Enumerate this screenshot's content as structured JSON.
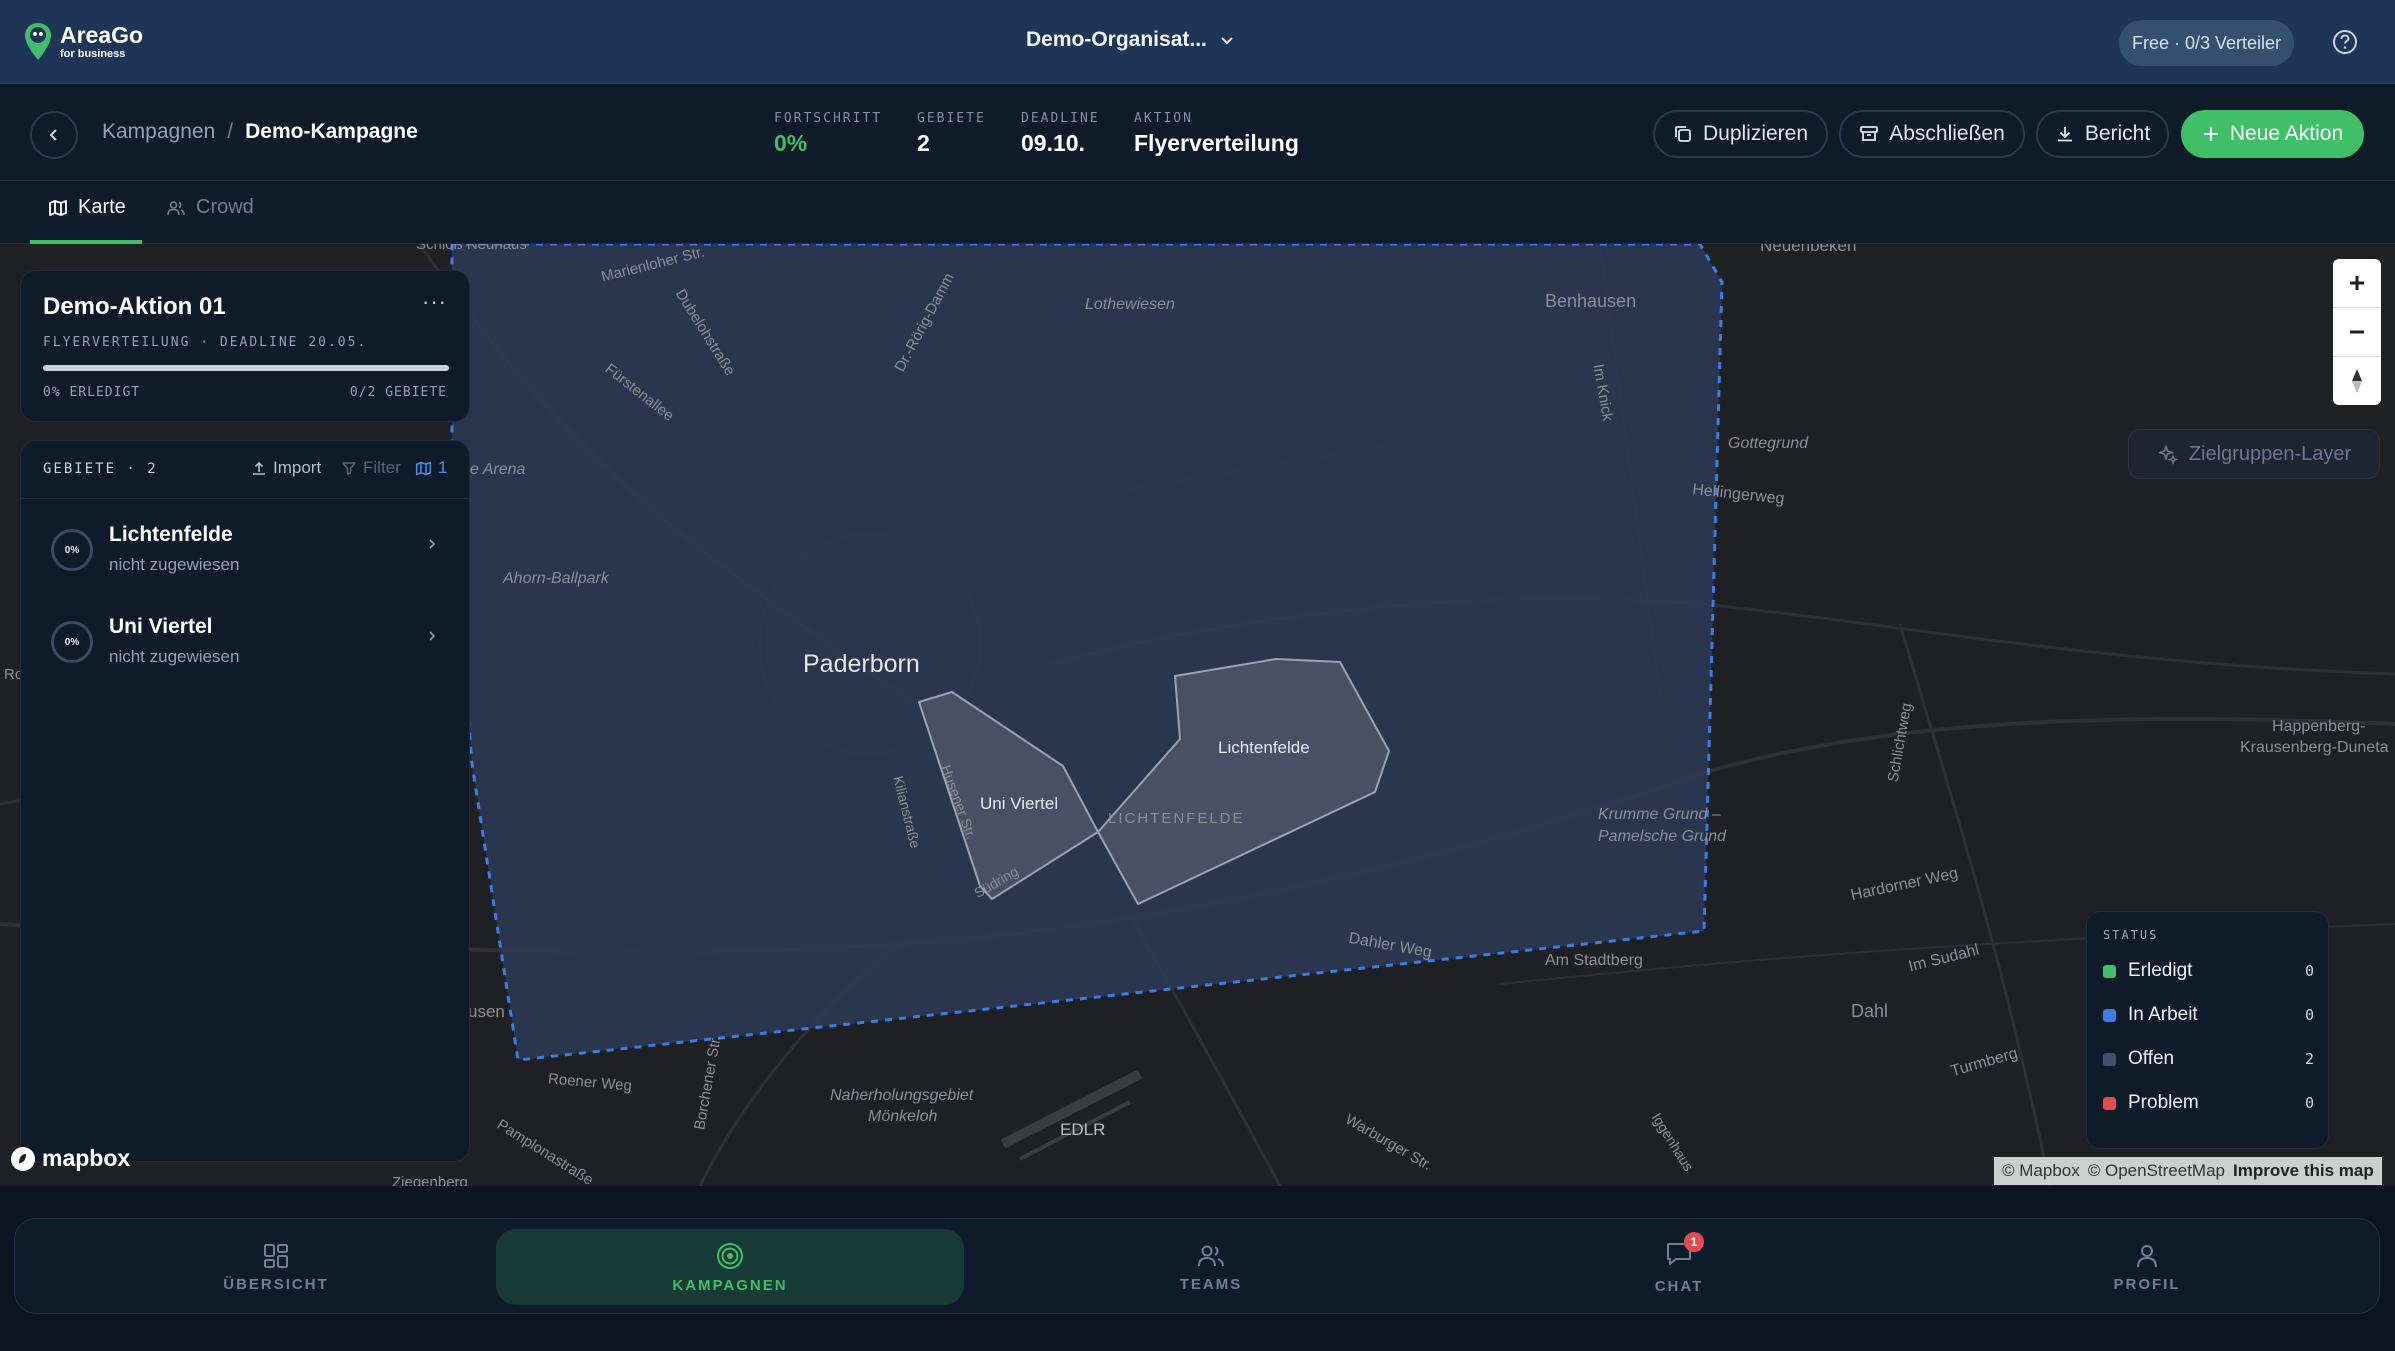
{
  "app": {
    "brand": "AreaGo",
    "brand_sub": "for business",
    "org_name": "Demo-Organisat...",
    "plan": "Free · 0/3 Verteiler"
  },
  "breadcrumb": {
    "parent": "Kampagnen",
    "separator": "/",
    "current": "Demo-Kampagne"
  },
  "stats": {
    "progress": {
      "label": "FORTSCHRITT",
      "value": "0%"
    },
    "areas": {
      "label": "GEBIETE",
      "value": "2"
    },
    "deadline": {
      "label": "DEADLINE",
      "value": "09.10."
    },
    "action": {
      "label": "AKTION",
      "value": "Flyerverteilung"
    }
  },
  "header_buttons": {
    "duplicate": "Duplizieren",
    "close": "Abschließen",
    "report": "Bericht",
    "new_action": "Neue Aktion"
  },
  "tabs": [
    {
      "label": "Karte",
      "icon": "map-icon",
      "active": true
    },
    {
      "label": "Crowd",
      "icon": "users-icon",
      "active": false
    }
  ],
  "action_card": {
    "title": "Demo-Aktion 01",
    "more": "···",
    "meta": "FLYERVERTEILUNG · DEADLINE 20.05.",
    "progress_fraction": 0,
    "done_label": "0% ERLEDIGT",
    "areas_label": "0/2 GEBIETE"
  },
  "areas_panel": {
    "title": "GEBIETE · 2",
    "import": "Import",
    "filter": "Filter",
    "map_count": "1",
    "items": [
      {
        "name": "Lichtenfelde",
        "status": "nicht zugewiesen",
        "progress": "0%"
      },
      {
        "name": "Uni Viertel",
        "status": "nicht zugewiesen",
        "progress": "0%"
      }
    ]
  },
  "map": {
    "labels": {
      "paderborn": "Paderborn",
      "benhausen": "Benhausen",
      "dahl": "Dahl",
      "lothewiesen": "Lothewiesen",
      "ahorn": "Ahorn-Ballpark",
      "arena": "e Arena",
      "gottegrund": "Gottegrund",
      "hellinger": "Hellingerweg",
      "krumme1": "Krumme Grund –",
      "krumme2": "Pamelsche Grund",
      "happenberg1": "Happenberg-",
      "happenberg2": "Krausenberg-Duneta",
      "hardorner": "Hardorner Weg",
      "imsudahl": "Im Sudahl",
      "turmberg": "Turmberg",
      "amstadtberg": "Am Stadtberg",
      "dahlerweg": "Dahler Weg",
      "lichtenfelde_dist": "LICHTENFELDE",
      "roener": "Roener Weg",
      "naherholung1": "Naherholungsgebiet",
      "naherholung2": "Mönkeloh",
      "edlr": "EDLR",
      "marienloher": "Marienloher Str.",
      "dubelohstr": "Dubelohstraße",
      "fuerstenallee": "Fürstenallee",
      "drroerig": "Dr.-Rörig-Damm",
      "imknick": "Im Knick",
      "schlichweg": "Schlichtweg",
      "kilianstr": "Kilianstraße",
      "warburger": "Warburger Str.",
      "pamplona": "Pamplonastraße",
      "borchener": "Borchener Str.",
      "neuhaus": "Schloß Neuhaus",
      "neuenbeken": "Neuenbeken",
      "ziegenberg": "Ziegenberg",
      "usen": "usen",
      "iggenhausen": "Iggenhaus",
      "sudring": "Südring",
      "husener": "Husener Str.",
      "ro": "Ro"
    },
    "polygons": {
      "lichtenfelde": "Lichtenfelde",
      "uni_viertel": "Uni Viertel"
    },
    "layer_button": "Zielgruppen-Layer",
    "zoom_in": "+",
    "zoom_out": "−"
  },
  "legend": {
    "title": "STATUS",
    "items": [
      {
        "label": "Erledigt",
        "count": "0",
        "color": "#3fbf66"
      },
      {
        "label": "In Arbeit",
        "count": "0",
        "color": "#3b7ce6"
      },
      {
        "label": "Offen",
        "count": "2",
        "color": "#3f5170"
      },
      {
        "label": "Problem",
        "count": "0",
        "color": "#e24c4c"
      }
    ]
  },
  "attribution": {
    "mapbox_logo": "mapbox",
    "mapbox": "© Mapbox",
    "osm": "© OpenStreetMap",
    "improve": "Improve this map"
  },
  "bottom_nav": [
    {
      "label": "ÜBERSICHT",
      "icon": "grid-icon",
      "active": false
    },
    {
      "label": "KAMPAGNEN",
      "icon": "target-icon",
      "active": true
    },
    {
      "label": "TEAMS",
      "icon": "users-icon",
      "active": false
    },
    {
      "label": "CHAT",
      "icon": "chat-icon",
      "active": false,
      "badge": "1"
    },
    {
      "label": "PROFIL",
      "icon": "user-icon",
      "active": false
    }
  ],
  "colors": {
    "accent": "#3fbf66",
    "topbar": "#1e3557",
    "panel": "#0f1a2b",
    "map_bg": "#1f2023",
    "campaign_area": "#2b3953",
    "boundary": "#3b7ce6"
  }
}
